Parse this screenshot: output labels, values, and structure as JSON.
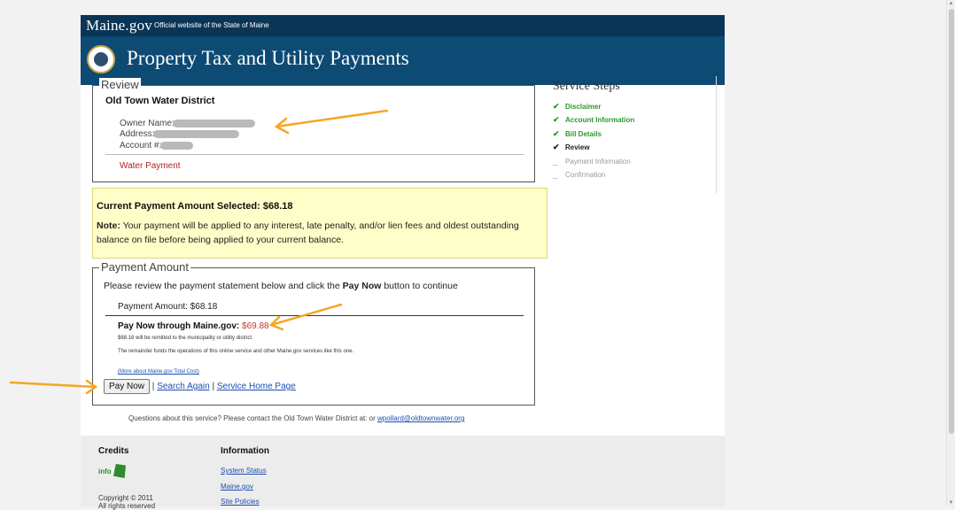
{
  "header": {
    "gov_logo": "Maine.gov",
    "gov_tagline": "Official website of the State of Maine",
    "title": "Property Tax and Utility Payments"
  },
  "review": {
    "legend": "Review",
    "utility_name": "Old Town Water District",
    "owner_label": "Owner Name:",
    "address_label": "Address:",
    "account_label": "Account #:",
    "payment_type": "Water Payment"
  },
  "steps": {
    "title": "Service Steps",
    "items": [
      {
        "label": "Disclaimer",
        "state": "done"
      },
      {
        "label": "Account Information",
        "state": "done"
      },
      {
        "label": "Bill Details",
        "state": "done"
      },
      {
        "label": "Review",
        "state": "current"
      },
      {
        "label": "Payment Information",
        "state": "pending"
      },
      {
        "label": "Confirmation",
        "state": "pending"
      }
    ]
  },
  "note": {
    "amount_text": "Current Payment Amount Selected: $68.18",
    "note_label": "Note:",
    "note_text": " Your payment will be applied to any interest, late penalty, and/or lien fees and oldest outstanding balance on file before being applied to your current balance."
  },
  "payment": {
    "legend": "Payment Amount",
    "instruction_prefix": "Please review the payment statement below and click the ",
    "instruction_bold": "Pay Now",
    "instruction_suffix": " button to continue",
    "amount_line": "Payment Amount: $68.18",
    "pay_now_label": "Pay Now through Maine.gov: ",
    "pay_now_amount": "$69.88",
    "fine1": "$68.18 will be remitted to the municipality or utility district.",
    "fine2": "The remainder funds the operations of this online service and other Maine.gov services like this one.",
    "fine_link": "(More about Maine.gov Total Cost)",
    "pay_now_button": "Pay Now",
    "separator": "|",
    "search_again": "Search Again",
    "service_home": "Service Home Page"
  },
  "questions": {
    "text": "Questions about this service? Please contact the Old Town Water District at: or ",
    "email": "wpollard@oldtownwater.org"
  },
  "footer": {
    "credits_heading": "Credits",
    "informe_logo": "infoME",
    "copyright": "Copyright © 2011",
    "rights": "All rights reserved",
    "info_heading": "Information",
    "links": [
      "System Status",
      "Maine.gov",
      "Site Policies"
    ]
  },
  "colors": {
    "gov_bar": "#0a3556",
    "title_bar": "#0d4a74",
    "step_done": "#2a9a2a",
    "pay_now_amount": "#c0392b",
    "annotation_arrow": "#f5a623",
    "note_background": "#fefec8"
  }
}
